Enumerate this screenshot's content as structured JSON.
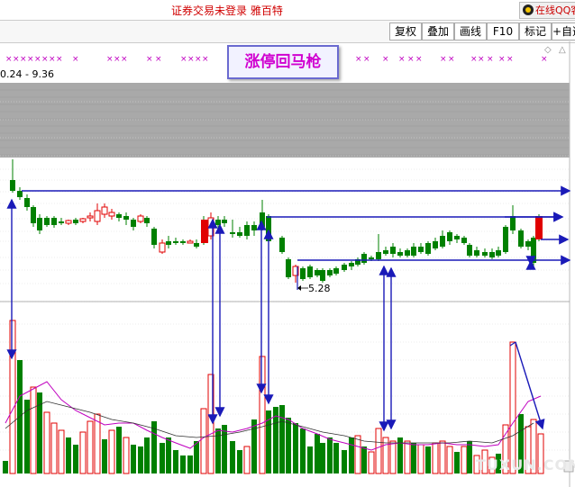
{
  "top_status": {
    "text": "证券交易未登录    雅百特",
    "qq_label": "在线QQ客"
  },
  "toolbar": {
    "buttons": [
      "复权",
      "叠加",
      "画线",
      "F10",
      "标记",
      "+自选"
    ]
  },
  "chart": {
    "title": "涨停回马枪",
    "range_label": "0.24 - 9.36",
    "low_label": "5.28",
    "watermark": "TUXUN.COM"
  },
  "colors": {
    "up": "#e00000",
    "down": "#008000",
    "arrow": "#1a1ab8",
    "ma_magenta": "#c000c0",
    "ma_dark": "#303030",
    "gray_band": "#a8a8a8"
  },
  "chart_data": {
    "type": "candlestick",
    "price_range": [
      5.28,
      9.36
    ],
    "volume_ma_series": [
      "magenta",
      "dark"
    ]
  }
}
